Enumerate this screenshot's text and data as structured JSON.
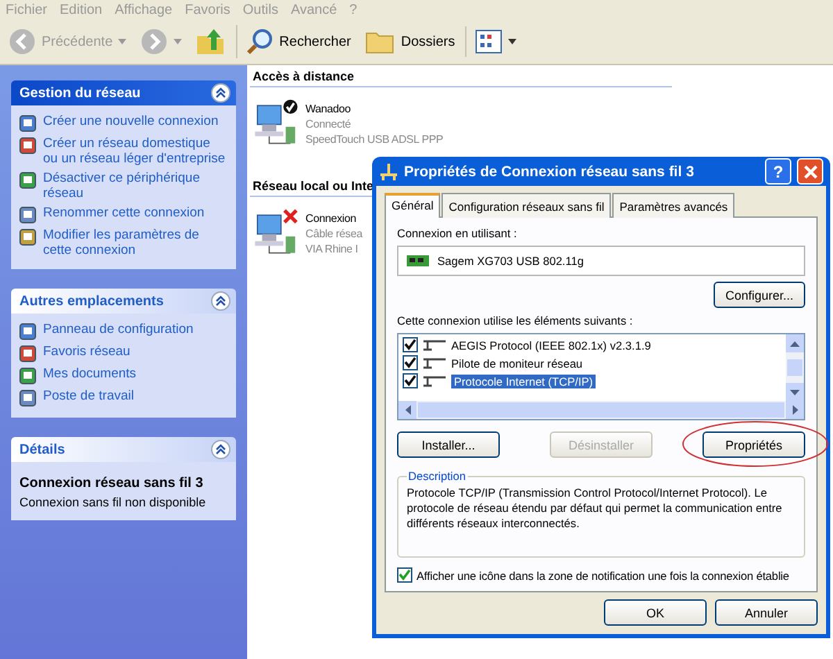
{
  "menu_bar": [
    "Fichier",
    "Edition",
    "Affichage",
    "Favoris",
    "Outils",
    "Avancé",
    "?"
  ],
  "toolbar": [
    {
      "kind": "back",
      "label": "Précédente",
      "disabled": true
    },
    {
      "kind": "forward",
      "disabled": true
    },
    {
      "kind": "up"
    },
    {
      "kind": "search",
      "label": "Rechercher"
    },
    {
      "kind": "folders",
      "label": "Dossiers"
    },
    {
      "kind": "views"
    }
  ],
  "sidebar": {
    "panels": [
      {
        "title": "Gestion du réseau",
        "kind": "special",
        "expanded": true,
        "items": [
          "Créer une nouvelle connexion",
          "Créer un réseau domestique ou un réseau léger d'entreprise",
          "Désactiver ce périphérique réseau",
          "Renommer cette connexion",
          "Modifier les paramètres de cette connexion"
        ]
      },
      {
        "title": "Autres emplacements",
        "kind": "normal",
        "expanded": true,
        "items": [
          "Panneau de configuration",
          "Favoris réseau",
          "Mes documents",
          "Poste de travail"
        ]
      },
      {
        "title": "Détails",
        "kind": "details",
        "expanded": true,
        "name": "Connexion réseau sans fil 3",
        "status": "Connexion sans fil non disponible"
      }
    ]
  },
  "groups": [
    {
      "title": "Accès à distance",
      "connections": [
        {
          "name": "Wanadoo",
          "status": "Connecté",
          "device": "SpeedTouch USB ADSL PPP",
          "connected": true
        }
      ]
    },
    {
      "title": "Réseau local ou Inte",
      "connections": [
        {
          "name": "Connexion",
          "status": "Câble résea",
          "device": "VIA Rhine I",
          "connected": false
        }
      ]
    }
  ],
  "dialog": {
    "title": "Propriétés de Connexion réseau sans fil 3",
    "help": "?",
    "tabs": [
      {
        "label": "Général",
        "selected": true
      },
      {
        "label": "Configuration réseaux sans fil",
        "selected": false
      },
      {
        "label": "Paramètres avancés",
        "selected": false
      }
    ],
    "connect_using_label": "Connexion en utilisant :",
    "adapter": "Sagem XG703 USB 802.11g",
    "configure_button": "Configurer...",
    "components_label": "Cette connexion utilise les éléments suivants :",
    "components": [
      {
        "label": "AEGIS Protocol (IEEE 802.1x) v2.3.1.9",
        "checked": true,
        "selected": false
      },
      {
        "label": "Pilote de moniteur réseau",
        "checked": true,
        "selected": false
      },
      {
        "label": "Protocole Internet (TCP/IP)",
        "checked": true,
        "selected": true
      }
    ],
    "buttons": [
      {
        "label": "Installer...",
        "disabled": false,
        "circled": false
      },
      {
        "label": "Désinstaller",
        "disabled": true,
        "circled": false
      },
      {
        "label": "Propriétés",
        "disabled": false,
        "circled": true
      }
    ],
    "description_title": "Description",
    "description": "Protocole TCP/IP (Transmission Control Protocol/Internet Protocol). Le protocole de réseau étendu par défaut qui permet la communication entre différents réseaux interconnectés.",
    "notify": {
      "label": "Afficher une icône dans la zone de notification une fois la connexion établie",
      "checked": true
    },
    "ok": "OK",
    "cancel": "Annuler"
  }
}
